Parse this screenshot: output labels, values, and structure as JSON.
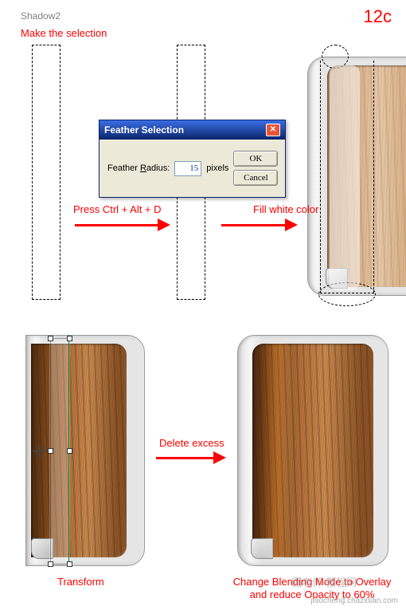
{
  "header": {
    "title": "Shadow2",
    "step": "12c"
  },
  "instructions": {
    "make_selection": "Make the selection",
    "press_keys": "Press Ctrl + Alt + D",
    "fill_white": "Fill white color",
    "transform": "Transform",
    "delete_excess": "Delete excess",
    "blend_line1": "Change Blending Mode to Overlay",
    "blend_line2": "and reduce Opacity to 60%"
  },
  "dialog": {
    "title": "Feather Selection",
    "label": "Feather Radius:",
    "value": "15",
    "unit": "pixels",
    "ok": "OK",
    "cancel": "Cancel"
  },
  "watermark": {
    "cn": "图老师 教程网",
    "url": "jiaocheng.chazidian.com"
  }
}
